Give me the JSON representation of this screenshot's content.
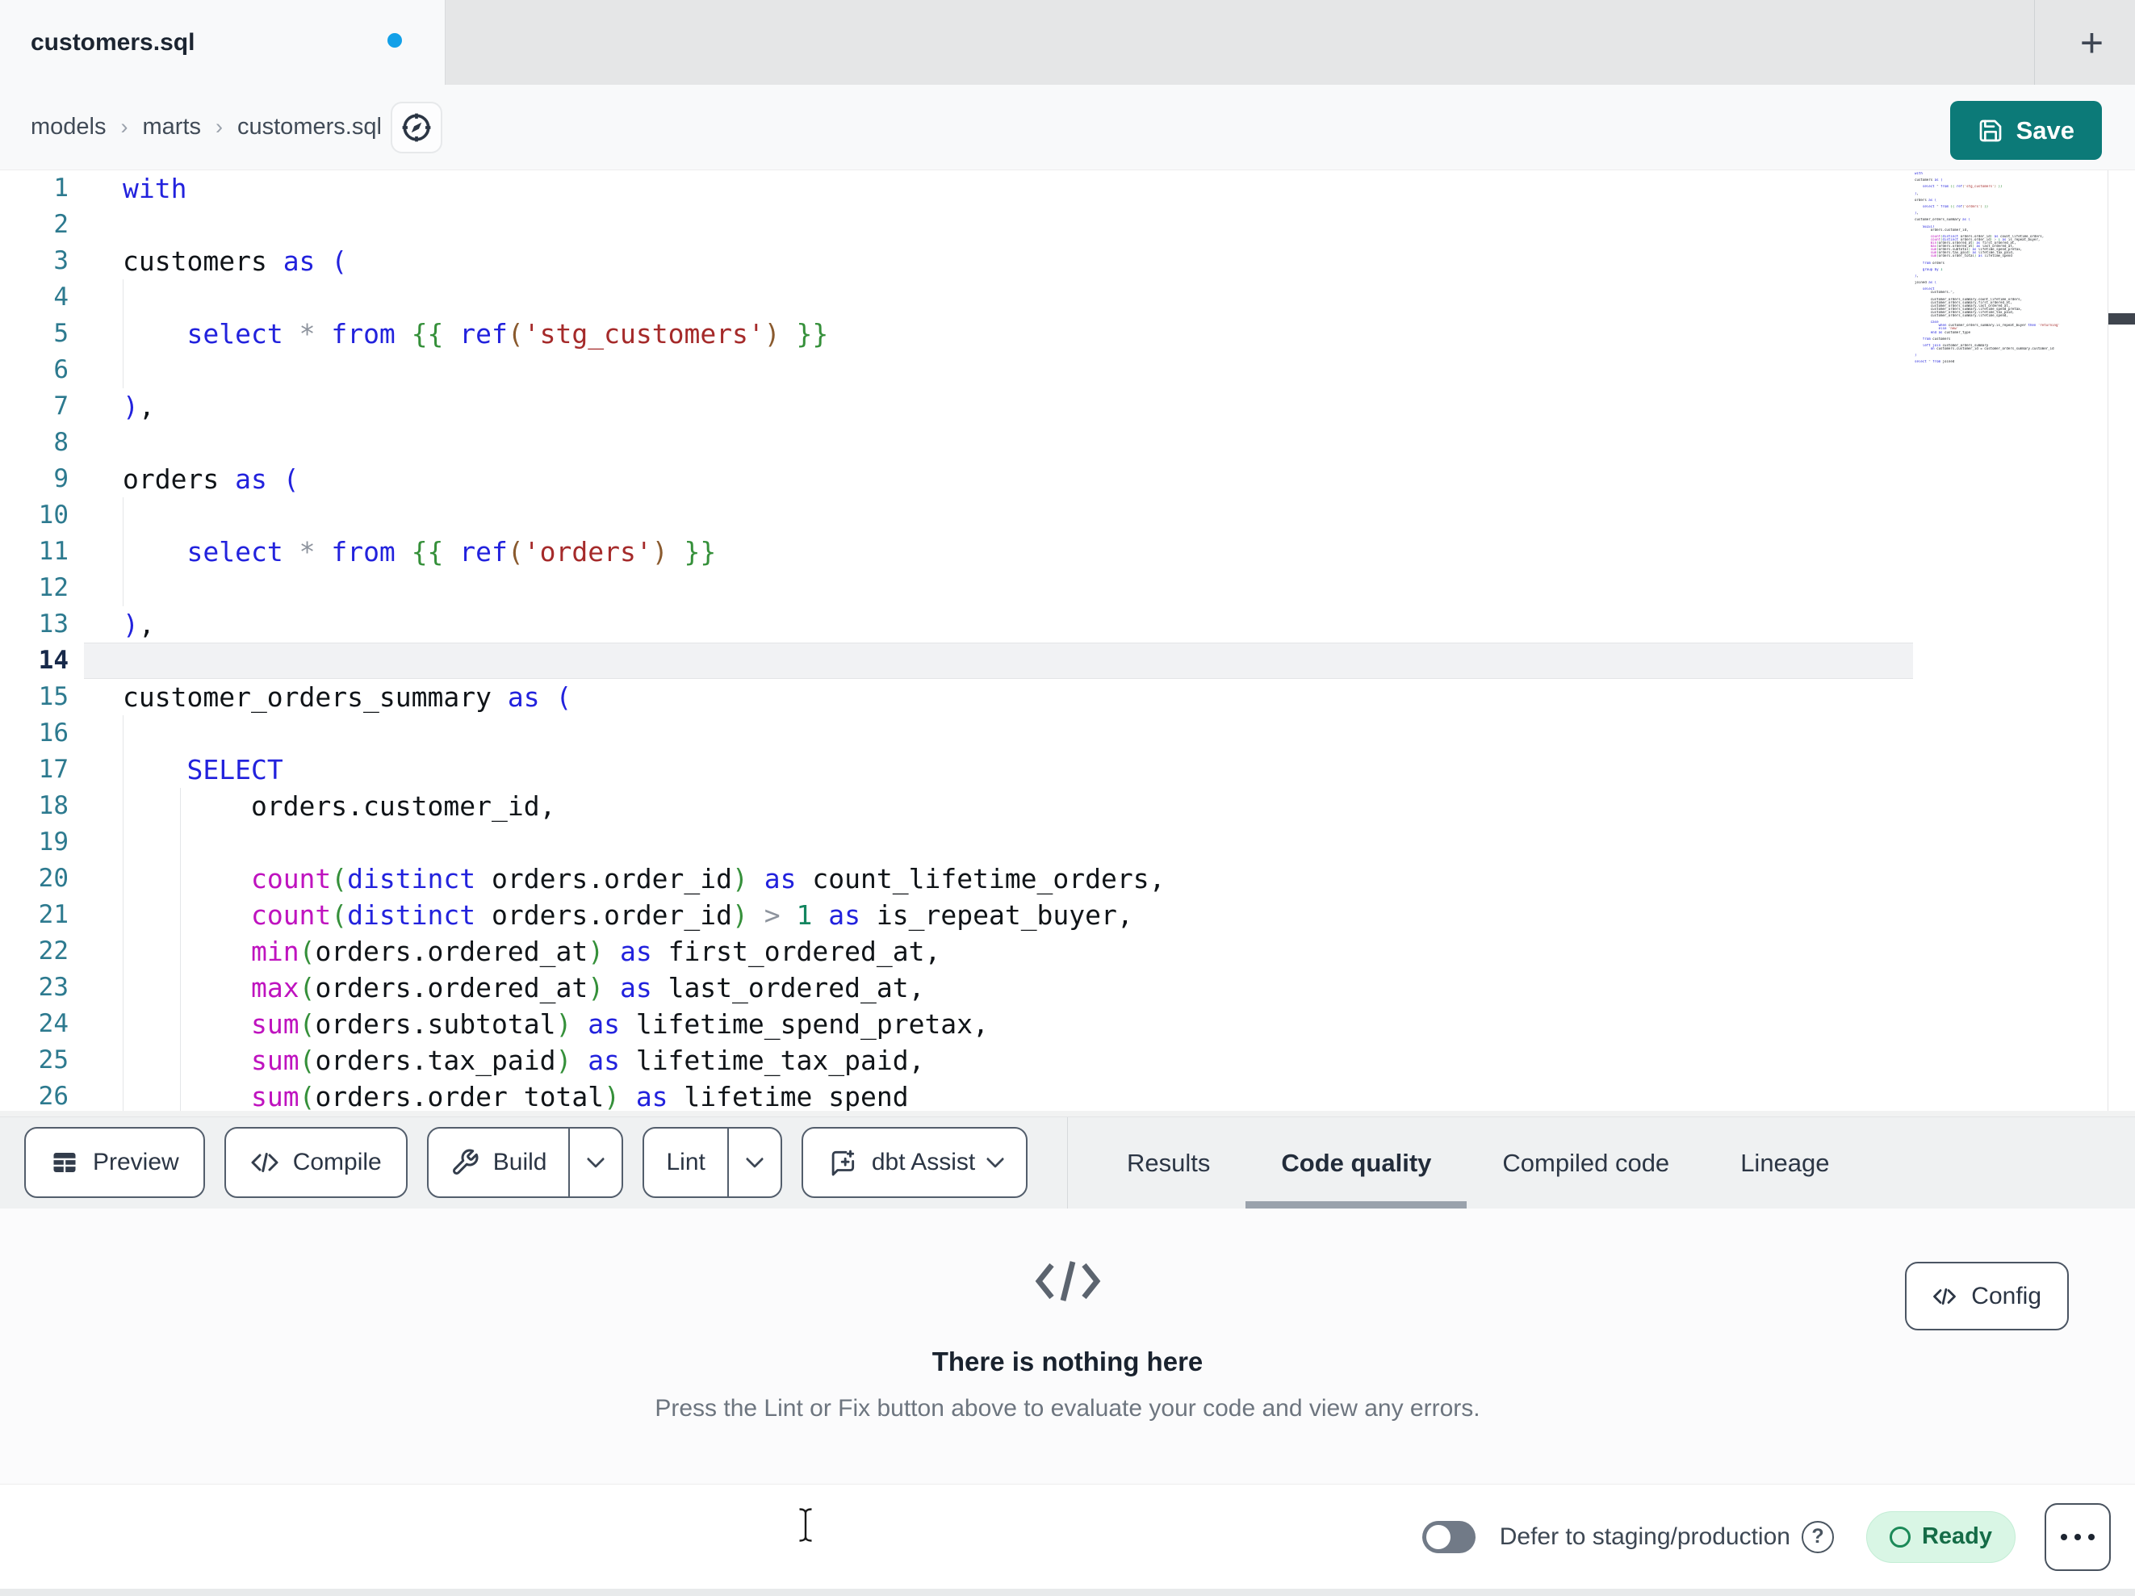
{
  "tab_bar": {
    "tab_title": "customers.sql",
    "new_tab_label": "+"
  },
  "breadcrumb": {
    "items": [
      "models",
      "marts",
      "customers.sql"
    ],
    "separator": "›"
  },
  "header": {
    "save_label": "Save"
  },
  "colors": {
    "accent_teal": "#0c7a78",
    "dirty_dot_blue": "#12a0e8",
    "ready_bg": "#d9f6e5",
    "ready_text": "#156c47",
    "syntax_keyword": "#2222dd",
    "syntax_function": "#bf13bf",
    "syntax_string": "#a52a2a",
    "syntax_jinja": "#35903a",
    "syntax_number": "#13855f",
    "line_number": "#2d7a8f"
  },
  "editor": {
    "visible_count": 26,
    "active_line": 14,
    "lines": [
      {
        "g": 0,
        "t": [
          [
            "k",
            "with"
          ]
        ]
      },
      {
        "g": 0,
        "t": []
      },
      {
        "g": 0,
        "t": [
          [
            "p",
            "customers "
          ],
          [
            "k",
            "as"
          ],
          [
            "p",
            " "
          ],
          [
            "k",
            "("
          ]
        ]
      },
      {
        "g": 1,
        "t": []
      },
      {
        "g": 1,
        "t": [
          [
            "p",
            "    "
          ],
          [
            "k",
            "select"
          ],
          [
            "p",
            " "
          ],
          [
            "o",
            "*"
          ],
          [
            "p",
            " "
          ],
          [
            "k",
            "from"
          ],
          [
            "p",
            " "
          ],
          [
            "g",
            "{{ "
          ],
          [
            "k",
            "ref"
          ],
          [
            "b",
            "("
          ],
          [
            "s",
            "'stg_customers'"
          ],
          [
            "b",
            ")"
          ],
          [
            "g",
            " }}"
          ]
        ]
      },
      {
        "g": 1,
        "t": []
      },
      {
        "g": 0,
        "t": [
          [
            "k",
            ")"
          ],
          [
            "p",
            ","
          ]
        ]
      },
      {
        "g": 0,
        "t": []
      },
      {
        "g": 0,
        "t": [
          [
            "p",
            "orders "
          ],
          [
            "k",
            "as"
          ],
          [
            "p",
            " "
          ],
          [
            "k",
            "("
          ]
        ]
      },
      {
        "g": 1,
        "t": []
      },
      {
        "g": 1,
        "t": [
          [
            "p",
            "    "
          ],
          [
            "k",
            "select"
          ],
          [
            "p",
            " "
          ],
          [
            "o",
            "*"
          ],
          [
            "p",
            " "
          ],
          [
            "k",
            "from"
          ],
          [
            "p",
            " "
          ],
          [
            "g",
            "{{ "
          ],
          [
            "k",
            "ref"
          ],
          [
            "b",
            "("
          ],
          [
            "s",
            "'orders'"
          ],
          [
            "b",
            ")"
          ],
          [
            "g",
            " }}"
          ]
        ]
      },
      {
        "g": 1,
        "t": []
      },
      {
        "g": 0,
        "t": [
          [
            "k",
            ")"
          ],
          [
            "p",
            ","
          ]
        ]
      },
      {
        "g": 0,
        "t": []
      },
      {
        "g": 0,
        "t": [
          [
            "p",
            "customer_orders_summary "
          ],
          [
            "k",
            "as"
          ],
          [
            "p",
            " "
          ],
          [
            "k",
            "("
          ]
        ]
      },
      {
        "g": 1,
        "t": []
      },
      {
        "g": 1,
        "t": [
          [
            "p",
            "    "
          ],
          [
            "k",
            "SELECT"
          ]
        ]
      },
      {
        "g": 2,
        "t": [
          [
            "p",
            "        orders.customer_id,"
          ]
        ]
      },
      {
        "g": 2,
        "t": []
      },
      {
        "g": 2,
        "t": [
          [
            "p",
            "        "
          ],
          [
            "f",
            "count"
          ],
          [
            "g",
            "("
          ],
          [
            "k",
            "distinct"
          ],
          [
            "p",
            " orders.order_id"
          ],
          [
            "g",
            ")"
          ],
          [
            "p",
            " "
          ],
          [
            "k",
            "as"
          ],
          [
            "p",
            " count_lifetime_orders,"
          ]
        ]
      },
      {
        "g": 2,
        "t": [
          [
            "p",
            "        "
          ],
          [
            "f",
            "count"
          ],
          [
            "g",
            "("
          ],
          [
            "k",
            "distinct"
          ],
          [
            "p",
            " orders.order_id"
          ],
          [
            "g",
            ")"
          ],
          [
            "p",
            " "
          ],
          [
            "o",
            ">"
          ],
          [
            "p",
            " "
          ],
          [
            "n",
            "1"
          ],
          [
            "p",
            " "
          ],
          [
            "k",
            "as"
          ],
          [
            "p",
            " is_repeat_buyer,"
          ]
        ]
      },
      {
        "g": 2,
        "t": [
          [
            "p",
            "        "
          ],
          [
            "f",
            "min"
          ],
          [
            "g",
            "("
          ],
          [
            "p",
            "orders.ordered_at"
          ],
          [
            "g",
            ")"
          ],
          [
            "p",
            " "
          ],
          [
            "k",
            "as"
          ],
          [
            "p",
            " first_ordered_at,"
          ]
        ]
      },
      {
        "g": 2,
        "t": [
          [
            "p",
            "        "
          ],
          [
            "f",
            "max"
          ],
          [
            "g",
            "("
          ],
          [
            "p",
            "orders.ordered_at"
          ],
          [
            "g",
            ")"
          ],
          [
            "p",
            " "
          ],
          [
            "k",
            "as"
          ],
          [
            "p",
            " last_ordered_at,"
          ]
        ]
      },
      {
        "g": 2,
        "t": [
          [
            "p",
            "        "
          ],
          [
            "f",
            "sum"
          ],
          [
            "g",
            "("
          ],
          [
            "p",
            "orders.subtotal"
          ],
          [
            "g",
            ")"
          ],
          [
            "p",
            " "
          ],
          [
            "k",
            "as"
          ],
          [
            "p",
            " lifetime_spend_pretax,"
          ]
        ]
      },
      {
        "g": 2,
        "t": [
          [
            "p",
            "        "
          ],
          [
            "f",
            "sum"
          ],
          [
            "g",
            "("
          ],
          [
            "p",
            "orders.tax_paid"
          ],
          [
            "g",
            ")"
          ],
          [
            "p",
            " "
          ],
          [
            "k",
            "as"
          ],
          [
            "p",
            " lifetime_tax_paid,"
          ]
        ]
      },
      {
        "g": 2,
        "t": [
          [
            "p",
            "        "
          ],
          [
            "f",
            "sum"
          ],
          [
            "g",
            "("
          ],
          [
            "p",
            "orders.order_total"
          ],
          [
            "g",
            ")"
          ],
          [
            "p",
            " "
          ],
          [
            "k",
            "as"
          ],
          [
            "p",
            " lifetime_spend"
          ]
        ]
      },
      {
        "g": 0,
        "t": []
      },
      {
        "g": 0,
        "t": [
          [
            "p",
            "    "
          ],
          [
            "k",
            "from"
          ],
          [
            "p",
            " orders"
          ]
        ]
      },
      {
        "g": 0,
        "t": []
      },
      {
        "g": 0,
        "t": [
          [
            "p",
            "    "
          ],
          [
            "k",
            "group by"
          ],
          [
            "p",
            " "
          ],
          [
            "n",
            "1"
          ]
        ]
      },
      {
        "g": 0,
        "t": []
      },
      {
        "g": 0,
        "t": [
          [
            "k",
            ")"
          ],
          [
            "p",
            ","
          ]
        ]
      },
      {
        "g": 0,
        "t": []
      },
      {
        "g": 0,
        "t": [
          [
            "p",
            "joined "
          ],
          [
            "k",
            "as"
          ],
          [
            "p",
            " "
          ],
          [
            "k",
            "("
          ]
        ]
      },
      {
        "g": 0,
        "t": []
      },
      {
        "g": 0,
        "t": [
          [
            "p",
            "    "
          ],
          [
            "k",
            "select"
          ]
        ]
      },
      {
        "g": 0,
        "t": [
          [
            "p",
            "        customers."
          ],
          [
            "o",
            "*"
          ],
          [
            "p",
            ","
          ]
        ]
      },
      {
        "g": 0,
        "t": []
      },
      {
        "g": 0,
        "t": [
          [
            "p",
            "        customer_orders_summary.count_lifetime_orders,"
          ]
        ]
      },
      {
        "g": 0,
        "t": [
          [
            "p",
            "        customer_orders_summary.first_ordered_at,"
          ]
        ]
      },
      {
        "g": 0,
        "t": [
          [
            "p",
            "        customer_orders_summary.last_ordered_at,"
          ]
        ]
      },
      {
        "g": 0,
        "t": [
          [
            "p",
            "        customer_orders_summary.lifetime_spend_pretax,"
          ]
        ]
      },
      {
        "g": 0,
        "t": [
          [
            "p",
            "        customer_orders_summary.lifetime_tax_paid,"
          ]
        ]
      },
      {
        "g": 0,
        "t": [
          [
            "p",
            "        customer_orders_summary.lifetime_spend,"
          ]
        ]
      },
      {
        "g": 0,
        "t": []
      },
      {
        "g": 0,
        "t": [
          [
            "p",
            "        "
          ],
          [
            "k",
            "case"
          ]
        ]
      },
      {
        "g": 0,
        "t": [
          [
            "p",
            "            "
          ],
          [
            "k",
            "when"
          ],
          [
            "p",
            " customer_orders_summary.is_repeat_buyer "
          ],
          [
            "k",
            "then"
          ],
          [
            "p",
            " "
          ],
          [
            "s",
            "'returning'"
          ]
        ]
      },
      {
        "g": 0,
        "t": [
          [
            "p",
            "            "
          ],
          [
            "k",
            "else"
          ],
          [
            "p",
            " "
          ],
          [
            "s",
            "'new'"
          ]
        ]
      },
      {
        "g": 0,
        "t": [
          [
            "p",
            "        "
          ],
          [
            "k",
            "end"
          ],
          [
            "p",
            " "
          ],
          [
            "k",
            "as"
          ],
          [
            "p",
            " customer_type"
          ]
        ]
      },
      {
        "g": 0,
        "t": []
      },
      {
        "g": 0,
        "t": [
          [
            "p",
            "    "
          ],
          [
            "k",
            "from"
          ],
          [
            "p",
            " customers"
          ]
        ]
      },
      {
        "g": 0,
        "t": []
      },
      {
        "g": 0,
        "t": [
          [
            "p",
            "    "
          ],
          [
            "k",
            "left join"
          ],
          [
            "p",
            " customer_orders_summary"
          ]
        ]
      },
      {
        "g": 0,
        "t": [
          [
            "p",
            "        "
          ],
          [
            "k",
            "on"
          ],
          [
            "p",
            " customers.customer_id = customer_orders_summary.customer_id"
          ]
        ]
      },
      {
        "g": 0,
        "t": []
      },
      {
        "g": 0,
        "t": [
          [
            "k",
            ")"
          ]
        ]
      },
      {
        "g": 0,
        "t": []
      },
      {
        "g": 0,
        "t": [
          [
            "k",
            "select"
          ],
          [
            "p",
            " "
          ],
          [
            "o",
            "*"
          ],
          [
            "p",
            " "
          ],
          [
            "k",
            "from"
          ],
          [
            "p",
            " joined"
          ]
        ]
      }
    ]
  },
  "toolbar": {
    "preview_label": "Preview",
    "compile_label": "Compile",
    "build_label": "Build",
    "lint_label": "Lint",
    "assist_label": "dbt Assist"
  },
  "panel_tabs": {
    "items": [
      "Results",
      "Code quality",
      "Compiled code",
      "Lineage"
    ],
    "active": "Code quality"
  },
  "empty_state": {
    "title": "There is nothing here",
    "subtitle": "Press the Lint or Fix button above to evaluate your code and view any errors.",
    "config_label": "Config"
  },
  "status_bar": {
    "defer_label": "Defer to staging/production",
    "help_glyph": "?",
    "ready_label": "Ready"
  }
}
